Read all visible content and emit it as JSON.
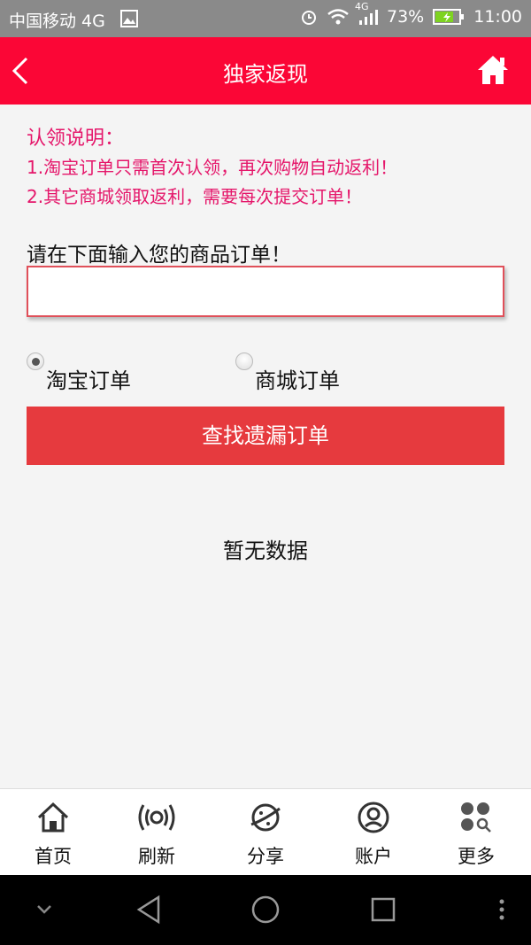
{
  "status_bar": {
    "carrier": "中国移动 4G",
    "network": "4G",
    "battery": "73%",
    "time": "11:00",
    "icons": [
      "image-icon",
      "alarm-icon",
      "wifi-icon",
      "signal-icon",
      "battery-icon"
    ]
  },
  "nav": {
    "title": "独家返现",
    "back_icon": "back-chevron-icon",
    "home_icon": "home-icon"
  },
  "notice": {
    "heading": "认领说明：",
    "line1": "1.淘宝订单只需首次认领，再次购物自动返利！",
    "line2": "2.其它商城领取返利，需要每次提交订单！"
  },
  "prompt": "请在下面输入您的商品订单！",
  "order_input": {
    "value": "",
    "placeholder": ""
  },
  "radios": [
    {
      "label": "淘宝订单",
      "checked": true
    },
    {
      "label": "商城订单",
      "checked": false
    }
  ],
  "find_button": "查找遗漏订单",
  "empty_text": "暂无数据",
  "tabs": [
    {
      "label": "首页",
      "icon": "home-icon"
    },
    {
      "label": "刷新",
      "icon": "broadcast-icon"
    },
    {
      "label": "分享",
      "icon": "planet-icon"
    },
    {
      "label": "账户",
      "icon": "user-icon"
    },
    {
      "label": "更多",
      "icon": "more-grid-icon"
    }
  ],
  "colors": {
    "nav_red": "#fb0636",
    "notice_pink": "#e5166a",
    "button_red": "#e63a3e",
    "status_gray": "#8a8a8a"
  }
}
